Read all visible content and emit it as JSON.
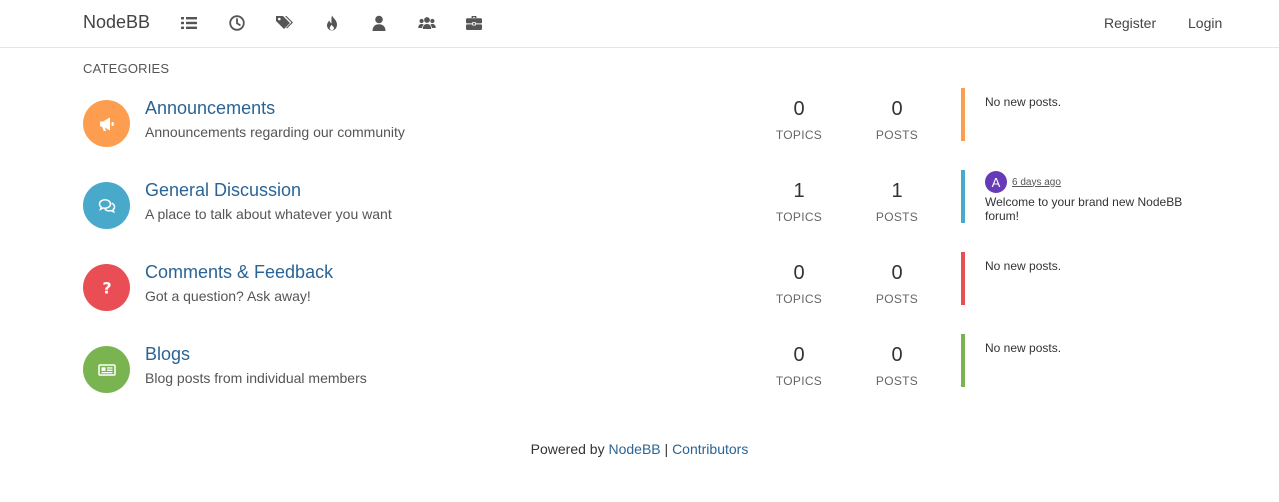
{
  "navbar": {
    "brand": "NodeBB",
    "icons": [
      "categories-icon",
      "recent-icon",
      "tags-icon",
      "popular-icon",
      "users-icon",
      "groups-icon",
      "briefcase-icon"
    ],
    "register": "Register",
    "login": "Login"
  },
  "section_title": "CATEGORIES",
  "categories": [
    {
      "title": "Announcements",
      "description": "Announcements regarding our community",
      "icon": "bullhorn-icon",
      "color": "#fd9d4f",
      "topics": "0",
      "posts": "0",
      "teaser": "No new posts."
    },
    {
      "title": "General Discussion",
      "description": "A place to talk about whatever you want",
      "icon": "comments-icon",
      "color": "#49a9cb",
      "topics": "1",
      "posts": "1",
      "teaser_avatar": "A",
      "teaser_time": "6 days ago",
      "teaser_post": "Welcome to your brand new NodeBB forum!"
    },
    {
      "title": "Comments & Feedback",
      "description": "Got a question? Ask away!",
      "icon": "question-icon",
      "color": "#e94e55",
      "topics": "0",
      "posts": "0",
      "teaser": "No new posts."
    },
    {
      "title": "Blogs",
      "description": "Blog posts from individual members",
      "icon": "newspaper-icon",
      "color": "#7ab451",
      "topics": "0",
      "posts": "0",
      "teaser": "No new posts."
    }
  ],
  "labels": {
    "topics": "TOPICS",
    "posts": "POSTS"
  },
  "footer": {
    "prefix": "Powered by",
    "link1": "NodeBB",
    "separator": "|",
    "link2": "Contributors"
  },
  "colors": {
    "link": "#2a6496",
    "avatar": "#673ab7"
  }
}
